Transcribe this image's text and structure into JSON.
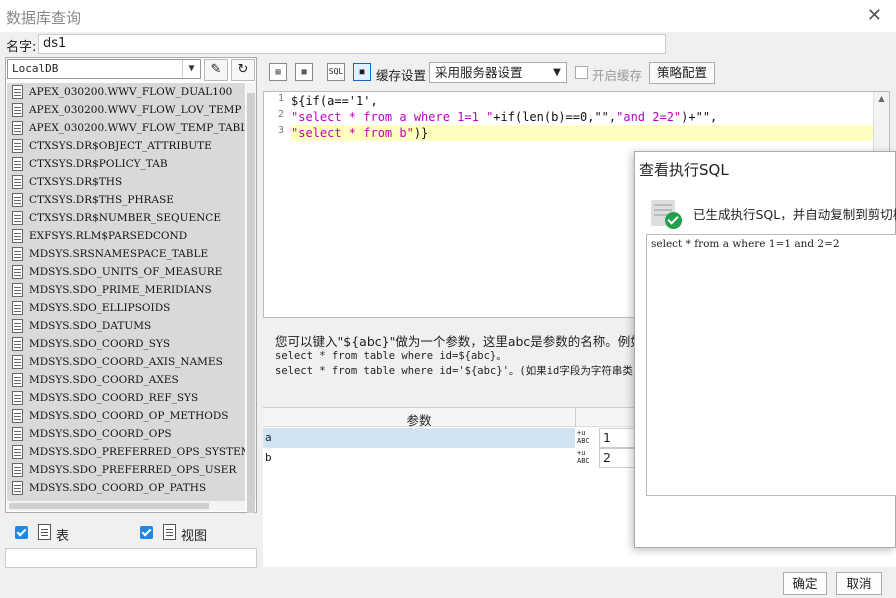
{
  "window": {
    "title": "数据库查询"
  },
  "name": {
    "label": "名字:",
    "value": "ds1"
  },
  "connection": {
    "selected": "LocalDB"
  },
  "tables": [
    "APEX_030200.WWV_FLOW_DUAL100",
    "APEX_030200.WWV_FLOW_LOV_TEMP",
    "APEX_030200.WWV_FLOW_TEMP_TABLE",
    "CTXSYS.DR$OBJECT_ATTRIBUTE",
    "CTXSYS.DR$POLICY_TAB",
    "CTXSYS.DR$THS",
    "CTXSYS.DR$THS_PHRASE",
    "CTXSYS.DR$NUMBER_SEQUENCE",
    "EXFSYS.RLM$PARSEDCOND",
    "MDSYS.SRSNAMESPACE_TABLE",
    "MDSYS.SDO_UNITS_OF_MEASURE",
    "MDSYS.SDO_PRIME_MERIDIANS",
    "MDSYS.SDO_ELLIPSOIDS",
    "MDSYS.SDO_DATUMS",
    "MDSYS.SDO_COORD_SYS",
    "MDSYS.SDO_COORD_AXIS_NAMES",
    "MDSYS.SDO_COORD_AXES",
    "MDSYS.SDO_COORD_REF_SYS",
    "MDSYS.SDO_COORD_OP_METHODS",
    "MDSYS.SDO_COORD_OPS",
    "MDSYS.SDO_PREFERRED_OPS_SYSTEM",
    "MDSYS.SDO_PREFERRED_OPS_USER",
    "MDSYS.SDO_COORD_OP_PATHS"
  ],
  "filters": {
    "table_label": "表",
    "view_label": "视图"
  },
  "toolbar": {
    "cache_label": "缓存设置",
    "cache_select": "采用服务器设置",
    "enable_cache_label": "开启缓存",
    "strategy_button": "策略配置",
    "sql_icon_text": "SQL"
  },
  "editor": {
    "line_numbers": [
      "1",
      "2",
      "3"
    ],
    "line1": "${if(a=='1',",
    "line2a": "\"select * from a where 1=1 \"",
    "line2b": "+if(len(b)==0,\"\",",
    "line2c": "\"and 2=2\"",
    "line2d": ")+\"\",",
    "line3a": "\"select * from b\"",
    "line3b": ")}"
  },
  "help": {
    "line1": "您可以键入\"${abc}\"做为一个参数，这里abc是参数的名称。例如:",
    "line2": "select * from table where id=${abc}。",
    "line3": "select * from table where id='${abc}'。(如果id字段为字符串类"
  },
  "params": {
    "header": "参数",
    "type_icon_text": "ABC",
    "rows": [
      {
        "name": "a",
        "value": "1"
      },
      {
        "name": "b",
        "value": "2"
      }
    ]
  },
  "dialog": {
    "title": "查看执行SQL",
    "message": "已生成执行SQL，并自动复制到剪切板",
    "sql": "select * from a where 1=1 and 2=2"
  },
  "buttons": {
    "ok": "确定",
    "cancel": "取消"
  },
  "colors": {
    "accent": "#1e88e5",
    "highlight": "#ffffbf",
    "string": "#c000c0",
    "success": "#22a04b"
  }
}
